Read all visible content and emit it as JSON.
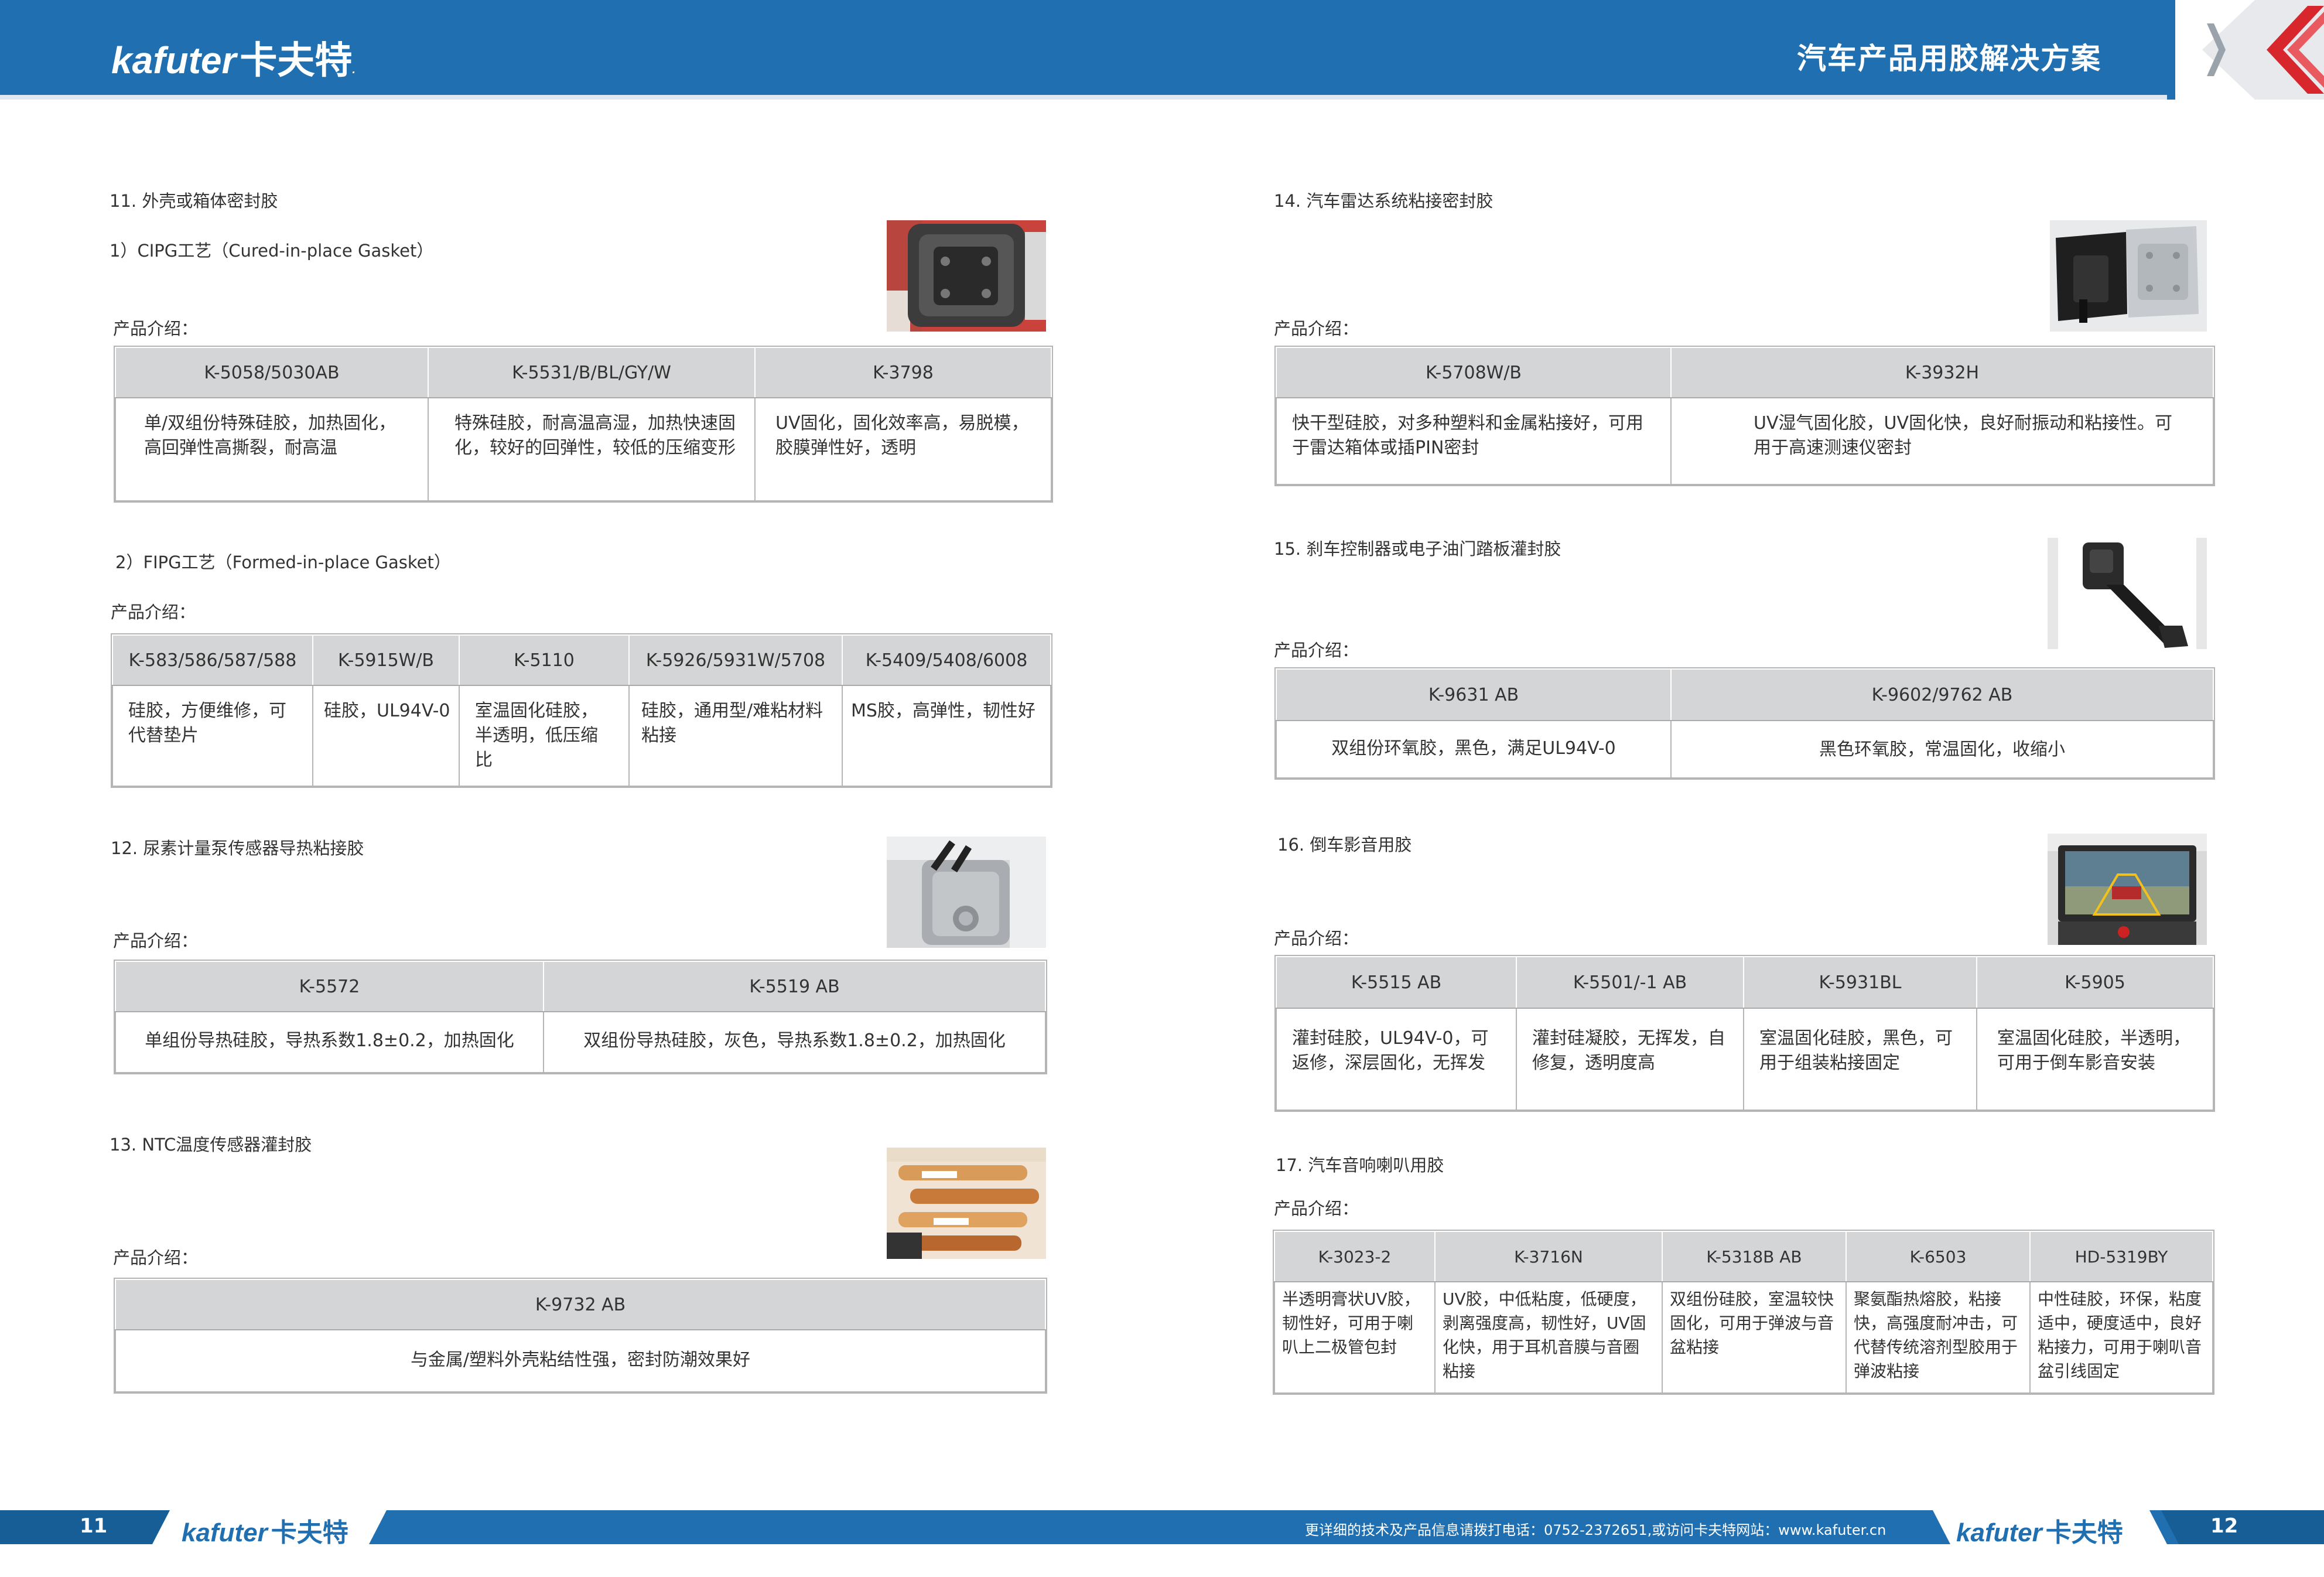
{
  "header": {
    "brand": "kafuter",
    "brand_cn": "卡夫特",
    "title": "汽车产品用胶解决方案"
  },
  "left": {
    "s11": {
      "title": "11. 外壳或箱体密封胶",
      "p1": {
        "title": "1）CIPG工艺（Cured-in-place Gasket）",
        "intro": "产品介绍：",
        "headers": [
          "K-5058/5030AB",
          "K-5531/B/BL/GY/W",
          "K-3798"
        ],
        "cells": [
          "单/双组份特殊硅胶，加热固化，高回弹性高撕裂，耐高温",
          "特殊硅胶，耐高温高湿，加热快速固化，较好的回弹性，较低的压缩变形",
          "UV固化，固化效率高，易脱模，胶膜弹性好，透明"
        ]
      },
      "p2": {
        "title": "2）FIPG工艺（Formed-in-place Gasket）",
        "intro": "产品介绍：",
        "headers": [
          "K-583/586/587/588",
          "K-5915W/B",
          "K-5110",
          "K-5926/5931W/5708",
          "K-5409/5408/6008"
        ],
        "cells": [
          "硅胶，方便维修，可代替垫片",
          "硅胶，UL94V-0",
          "室温固化硅胶，半透明，低压缩比",
          "硅胶，通用型/难粘材料粘接",
          "MS胶，高弹性，韧性好"
        ]
      }
    },
    "s12": {
      "title": "12. 尿素计量泵传感器导热粘接胶",
      "intro": "产品介绍：",
      "headers": [
        "K-5572",
        "K-5519 AB"
      ],
      "cells": [
        "单组份导热硅胶，导热系数1.8±0.2，加热固化",
        "双组份导热硅胶，灰色，导热系数1.8±0.2，加热固化"
      ]
    },
    "s13": {
      "title": "13. NTC温度传感器灌封胶",
      "intro": "产品介绍：",
      "headers": [
        "K-9732 AB"
      ],
      "cells": [
        "与金属/塑料外壳粘结性强，密封防潮效果好"
      ]
    }
  },
  "right": {
    "s14": {
      "title": "14. 汽车雷达系统粘接密封胶",
      "intro": "产品介绍：",
      "headers": [
        "K-5708W/B",
        "K-3932H"
      ],
      "cells": [
        "快干型硅胶，对多种塑料和金属粘接好，可用于雷达箱体或插PIN密封",
        "UV湿气固化胶，UV固化快，良好耐振动和粘接性。可用于高速测速仪密封"
      ]
    },
    "s15": {
      "title": "15. 刹车控制器或电子油门踏板灌封胶",
      "intro": "产品介绍：",
      "headers": [
        "K-9631 AB",
        "K-9602/9762 AB"
      ],
      "cells": [
        "双组份环氧胶，黑色，满足UL94V-0",
        "黑色环氧胶，常温固化，收缩小"
      ]
    },
    "s16": {
      "title": "16. 倒车影音用胶",
      "intro": "产品介绍：",
      "headers": [
        "K-5515 AB",
        "K-5501/-1 AB",
        "K-5931BL",
        "K-5905"
      ],
      "cells": [
        "灌封硅胶，UL94V-0，可返修，深层固化，无挥发",
        "灌封硅凝胶，无挥发，自修复，透明度高",
        "室温固化硅胶，黑色，可用于组装粘接固定",
        "室温固化硅胶，半透明，可用于倒车影音安装"
      ]
    },
    "s17": {
      "title": "17. 汽车音响喇叭用胶",
      "intro": "产品介绍：",
      "headers": [
        "K-3023-2",
        "K-3716N",
        "K-5318B AB",
        "K-6503",
        "HD-5319BY"
      ],
      "cells": [
        "半透明膏状UV胶，韧性好，可用于喇叭上二极管包封",
        "UV胶，中低粘度，低硬度，剥离强度高，韧性好，UV固化快，用于耳机音膜与音圈粘接",
        "双组份硅胶，室温较快固化，可用于弹波与音盆粘接",
        "聚氨酯热熔胶，粘接快，高强度耐冲击，可代替传统溶剂型胶用于弹波粘接",
        "中性硅胶，环保，粘度适中，硬度适中，良好粘接力，可用于喇叭音盆引线固定"
      ]
    }
  },
  "footer": {
    "left_page": "11",
    "right_page": "12",
    "contact": "更详细的技术及产品信息请拨打电话：0752-2372651,或访问卡夫特网站：www.kafuter.cn"
  },
  "colors": {
    "brand_blue": "#1f6fb1",
    "accent_red": "#d7262c",
    "table_header": "#d4d5d6"
  }
}
